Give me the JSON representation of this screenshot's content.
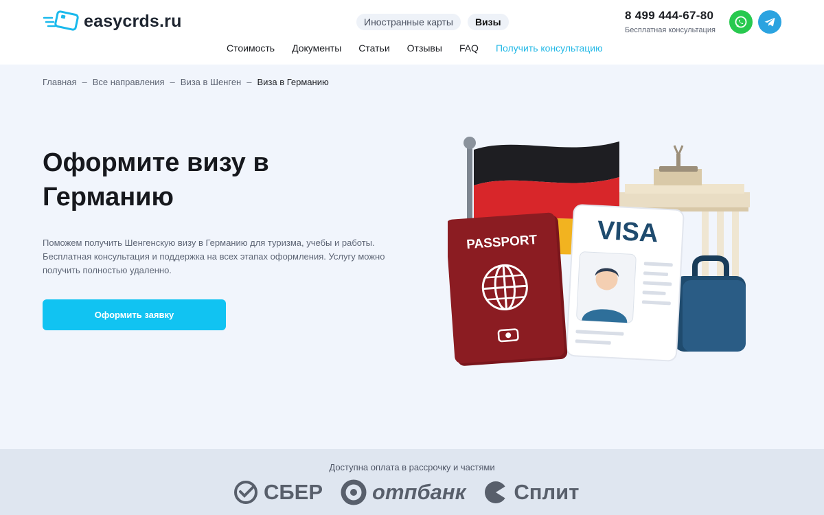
{
  "brand": {
    "name": "easycrds.ru"
  },
  "header": {
    "pills": [
      {
        "label": "Иностранные карты"
      },
      {
        "label": "Визы"
      }
    ],
    "phone": "8 499 444-67-80",
    "phone_sub": "Бесплатная консультация",
    "social": [
      "whatsapp-icon",
      "telegram-icon"
    ]
  },
  "nav": {
    "items": [
      "Стоимость",
      "Документы",
      "Статьи",
      "Отзывы",
      "FAQ"
    ],
    "accent_item": "Получить консультацию"
  },
  "breadcrumb": {
    "items": [
      "Главная",
      "Все направления",
      "Виза в Шенген"
    ],
    "separator": "–",
    "current": "Виза в Германию"
  },
  "hero": {
    "title": "Оформите визу в Германию",
    "description": "Поможем получить Шенгенскую визу в Германию для туризма, учебы и работы. Бесплатная консультация и поддержка на всех этапах оформления. Услугу можно получить полностью удаленно.",
    "cta_label": "Оформить заявку",
    "passport_text": "PASSPORT",
    "visa_text": "VISA"
  },
  "payment": {
    "title": "Доступна оплата в рассрочку и частями",
    "providers": [
      "СБЕР",
      "отпбанк",
      "Сплит"
    ]
  },
  "colors": {
    "accent": "#11c3f2",
    "hero_bg": "#f1f5fc",
    "whatsapp": "#28c94f",
    "telegram": "#2ba3e0",
    "passport_red": "#8b1c22",
    "visa_blue": "#1f4b6e"
  }
}
